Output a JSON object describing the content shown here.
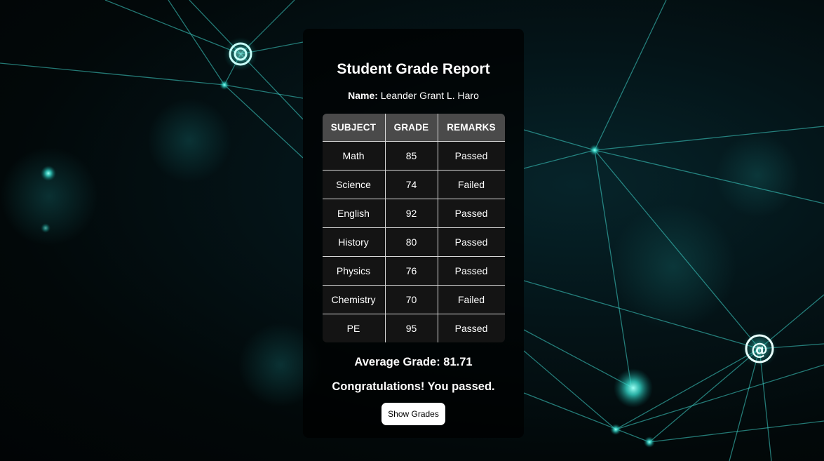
{
  "report": {
    "title": "Student Grade Report",
    "name_label": "Name:",
    "name_value": "Leander Grant L. Haro",
    "columns": [
      "SUBJECT",
      "GRADE",
      "REMARKS"
    ],
    "rows": [
      {
        "subject": "Math",
        "grade": "85",
        "remarks": "Passed"
      },
      {
        "subject": "Science",
        "grade": "74",
        "remarks": "Failed"
      },
      {
        "subject": "English",
        "grade": "92",
        "remarks": "Passed"
      },
      {
        "subject": "History",
        "grade": "80",
        "remarks": "Passed"
      },
      {
        "subject": "Physics",
        "grade": "76",
        "remarks": "Passed"
      },
      {
        "subject": "Chemistry",
        "grade": "70",
        "remarks": "Failed"
      },
      {
        "subject": "PE",
        "grade": "95",
        "remarks": "Passed"
      }
    ],
    "average_text": "Average Grade: 81.71",
    "message": "Congratulations! You passed.",
    "button_label": "Show Grades"
  },
  "colors": {
    "accent": "#3de0d4",
    "card": "#000000",
    "header_bg": "#4a4a4a"
  }
}
